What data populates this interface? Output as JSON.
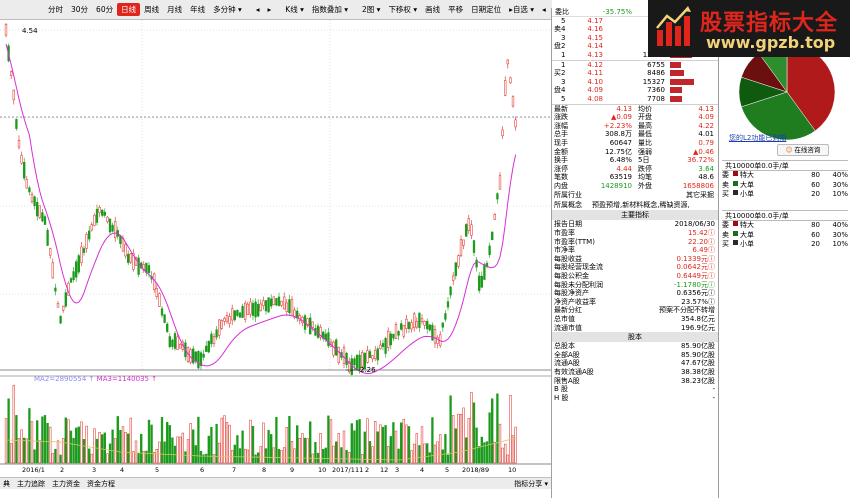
{
  "toolbar": {
    "items": [
      "分时",
      "30分",
      "60分",
      "日线",
      "周线",
      "月线",
      "年线",
      "多分钟 ▾",
      "◂",
      "▸",
      "K线 ▾",
      "指数叠加 ▾",
      "2图 ▾",
      "下移权 ▾",
      "画线",
      "平移",
      "日期定位",
      "▸自选 ▾",
      "◂",
      "▸"
    ],
    "active": "日线"
  },
  "chart": {
    "high_label": "4.54",
    "low_label": "2.26",
    "ma_labels": [
      "MA2=2890554 ↑",
      "MA3=1140035 ↑"
    ],
    "date_labels": [
      "2016/1",
      "2",
      "3",
      "4",
      "5",
      "6",
      "7",
      "8",
      "9",
      "10",
      "11",
      "12",
      "2017/1",
      "2",
      "3",
      "4",
      "5",
      "2018/8",
      "9",
      "10"
    ],
    "colors": {
      "up": "#e0261c",
      "down": "#1a9a1a",
      "ma": "#d630d6"
    }
  },
  "status_bar": {
    "tabs": [
      "典",
      "主力追踪",
      "主力资金",
      "资金方程"
    ],
    "right": "指标分享 ▾"
  },
  "order_book": {
    "weibi_label": "委比",
    "weibi_value": "-35.75%",
    "sell": [
      {
        "lv": "5",
        "price": "4.17",
        "vol": "",
        "bar": 0
      },
      {
        "lv": "4",
        "price": "4.16",
        "vol": "",
        "bar": 0
      },
      {
        "lv": "3",
        "price": "4.15",
        "vol": "",
        "bar": 0
      },
      {
        "lv": "2",
        "price": "4.14",
        "vol": "",
        "bar": 0
      },
      {
        "lv": "1",
        "price": "4.13",
        "vol": "13889",
        "bar": 0.55
      }
    ],
    "buy": [
      {
        "lv": "1",
        "price": "4.12",
        "vol": "6755",
        "bar": 0.27
      },
      {
        "lv": "2",
        "price": "4.11",
        "vol": "8486",
        "bar": 0.34
      },
      {
        "lv": "3",
        "price": "4.10",
        "vol": "15327",
        "bar": 0.61
      },
      {
        "lv": "4",
        "price": "4.09",
        "vol": "7360",
        "bar": 0.29
      },
      {
        "lv": "5",
        "price": "4.08",
        "vol": "7708",
        "bar": 0.31
      }
    ],
    "side_sell": [
      "卖",
      "盘"
    ],
    "side_buy": [
      "买",
      "盘"
    ]
  },
  "quote": [
    [
      "最新",
      "4.13",
      "均价",
      "4.13"
    ],
    [
      "涨跌",
      "▲0.09",
      "开盘",
      "4.09"
    ],
    [
      "涨幅",
      "+2.23%",
      "最高",
      "4.22"
    ],
    [
      "总手",
      "308.8万",
      "最低",
      "4.01"
    ],
    [
      "现手",
      "60647",
      "量比",
      "0.79"
    ],
    [
      "金额",
      "12.75亿",
      "强弱",
      "▲0.46"
    ],
    [
      "换手",
      "6.48%",
      "5日",
      "36.72%"
    ],
    [
      "涨停",
      "4.44",
      "跌停",
      "3.64"
    ],
    [
      "笔数",
      "63519",
      "均笔",
      "48.6"
    ],
    [
      "内盘",
      "1428910",
      "外盘",
      "1658806"
    ]
  ],
  "industry": {
    "label": "所属行业",
    "value": "其它采掘"
  },
  "concept": {
    "label": "所属概念",
    "value": "预盈预增,新材料概念,稀缺资源,"
  },
  "main_index": {
    "header": "主要指标",
    "rows": [
      [
        "报告日期",
        "2018/06/30"
      ],
      [
        "市盈率",
        "15.42ⓘ"
      ],
      [
        "市盈率(TTM)",
        "22.20ⓘ"
      ],
      [
        "市净率",
        "6.49ⓘ"
      ],
      [
        "每股收益",
        "0.1339元ⓘ"
      ],
      [
        "每股经营现金流",
        "0.0642元ⓘ"
      ],
      [
        "每股公积金",
        "0.6449元ⓘ"
      ],
      [
        "每股未分配利润",
        "-1.1780元ⓘ"
      ],
      [
        "每股净资产",
        "0.6356元ⓘ"
      ],
      [
        "净资产收益率",
        "23.57%ⓘ"
      ],
      [
        "最新分红",
        "预案不分配不转增"
      ],
      [
        "总市值",
        "354.8亿元"
      ],
      [
        "流通市值",
        "196.9亿元"
      ]
    ]
  },
  "equity": {
    "header": "股本",
    "rows": [
      [
        "总股本",
        "85.90亿股"
      ],
      [
        "全部A股",
        "85.90亿股"
      ],
      [
        "流通A股",
        "47.67亿股"
      ],
      [
        "有效流通A股",
        "38.38亿股"
      ],
      [
        "限售A股",
        "38.23亿股"
      ],
      [
        "B 股",
        "-"
      ],
      [
        "H 股",
        "-"
      ]
    ]
  },
  "logo": {
    "text": "股票指标大全",
    "url": "www.gpzb.top"
  },
  "pie": {
    "link": "您的L2功能已到期",
    "button": "在线咨询",
    "slices": [
      0.4,
      0.3,
      0.1,
      0.1,
      0.1
    ]
  },
  "flow1": {
    "title": "共10000单0.0手/单",
    "side": [
      "委",
      "卖",
      "买"
    ],
    "rows": [
      [
        "特大",
        "80",
        "40%"
      ],
      [
        "大单",
        "60",
        "30%"
      ],
      [
        "小单",
        "20",
        "10%"
      ]
    ]
  },
  "flow2": {
    "title": "共10000单0.0手/单",
    "side": [
      "委",
      "卖",
      "买"
    ],
    "rows": [
      [
        "特大",
        "80",
        "40%"
      ],
      [
        "大单",
        "60",
        "30%"
      ],
      [
        "小单",
        "20",
        "10%"
      ]
    ]
  }
}
